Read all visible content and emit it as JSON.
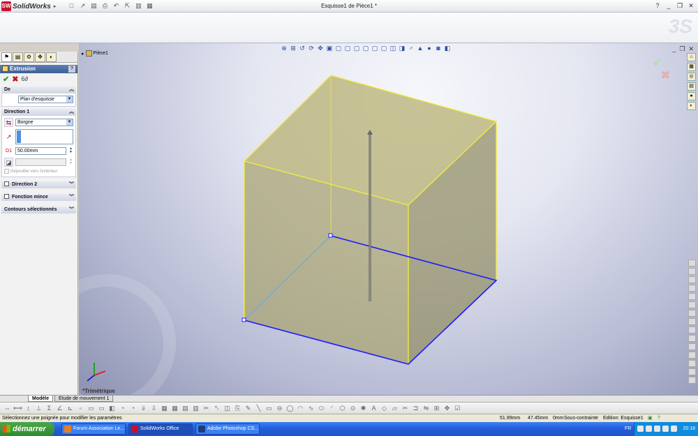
{
  "app": {
    "name": "SolidWorks",
    "document_title": "Esquisse1 de Pièce1 *"
  },
  "property_manager": {
    "feature_title": "Extrusion",
    "help_label": "?",
    "de": {
      "label": "De",
      "start": "Plan d'esquisse"
    },
    "direction1": {
      "label": "Direction 1",
      "end_condition": "Borgne",
      "depth": "50.00mm",
      "draft_outward": "Dépouiller vers l'extérieur"
    },
    "direction2": {
      "label": "Direction 2"
    },
    "thin_feature": {
      "label": "Fonction mince"
    },
    "selected_contours": {
      "label": "Contours sélectionnés"
    }
  },
  "viewport": {
    "tree_root": "Pièce1",
    "view_name": "*Trimétrique"
  },
  "bottom_tabs": {
    "model": "Modèle",
    "motion": "Etude de mouvement 1"
  },
  "statusbar": {
    "message": "Sélectionnez une poignée pour modifier les paramètres",
    "x": "51.99mm",
    "y": "47.45mm",
    "z": "0mm",
    "state": "Sous-contrainte",
    "edit": "Edition: Esquisse1"
  },
  "taskbar": {
    "start_label": "démarrer",
    "tasks": [
      {
        "label": "Forum Association Le..."
      },
      {
        "label": "SolidWorks Office Pro..."
      },
      {
        "label": "Adobe Photoshop CS..."
      }
    ],
    "language": "FR",
    "clock": "20:18"
  },
  "colors": {
    "cube_face": "#c8c08a",
    "sketch_blue": "#1a1aff",
    "edge_yellow": "#ffff33",
    "taskbar": "#245edb"
  }
}
